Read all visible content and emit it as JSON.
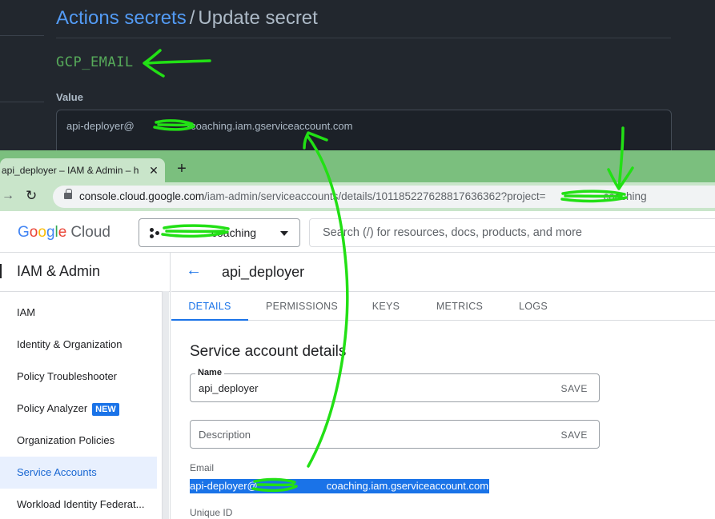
{
  "github": {
    "breadcrumb_link": "Actions secrets",
    "breadcrumb_sep": "/",
    "breadcrumb_current": "Update secret",
    "secret_name": "GCP_EMAIL",
    "value_label": "Value",
    "value_prefix": "api-deployer@",
    "value_suffix": "-coaching.iam.gserviceaccount.com"
  },
  "browser": {
    "tab_title": "api_deployer – IAM & Admin – h",
    "new_tab": "+",
    "url_host": "console.cloud.google.com",
    "url_path": "/iam-admin/serviceaccounts/details/101185227628817636362?project=",
    "url_suffix": "coaching"
  },
  "gcp": {
    "logo_google": [
      "G",
      "o",
      "o",
      "g",
      "l",
      "e"
    ],
    "logo_cloud": "Cloud",
    "project_name": "coaching",
    "search_placeholder": "Search (/) for resources, docs, products, and more"
  },
  "sidebar": {
    "title": "IAM & Admin",
    "items": [
      {
        "label": "IAM"
      },
      {
        "label": "Identity & Organization"
      },
      {
        "label": "Policy Troubleshooter"
      },
      {
        "label": "Policy Analyzer",
        "badge": "NEW"
      },
      {
        "label": "Organization Policies"
      },
      {
        "label": "Service Accounts",
        "active": true
      },
      {
        "label": "Workload Identity Federat..."
      }
    ]
  },
  "main": {
    "title": "api_deployer",
    "tabs": [
      "DETAILS",
      "PERMISSIONS",
      "KEYS",
      "METRICS",
      "LOGS"
    ],
    "active_tab": "DETAILS",
    "section_title": "Service account details",
    "name_label": "Name",
    "name_value": "api_deployer",
    "save_label": "SAVE",
    "description_placeholder": "Description",
    "email_label": "Email",
    "email_prefix": "api-deployer@",
    "email_suffix": "coaching.iam.gserviceaccount.com",
    "unique_id_label": "Unique ID"
  },
  "colors": {
    "annotation_green": "#22e015",
    "gh_bg": "#22272e",
    "gh_link": "#539bf5",
    "gh_secret": "#57ab5a",
    "tabstrip_green": "#7bbf7e",
    "accent_blue": "#1a73e8"
  }
}
